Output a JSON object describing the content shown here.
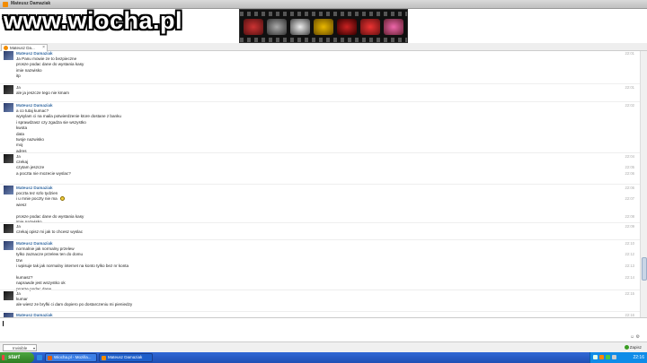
{
  "window": {
    "title": "Mateusz Damaziak"
  },
  "watermark": "www.wiocha.pl",
  "tab": {
    "label": "Mateusz Da..."
  },
  "messages": [
    {
      "sender": "Mateusz Damaziak",
      "kind": "mateusz",
      "time": "22:01",
      "lines": [
        "Ja Panu mowie ze to bezpieczne",
        "prosze podac dane do wystania kasy",
        "imie nazwisko",
        "itp"
      ]
    },
    {
      "sender": "Ja",
      "kind": "ja",
      "time": "22:01",
      "lines": [
        "ale ja jeszcze tego nie kmam"
      ]
    },
    {
      "sender": "Mateusz Damaziak",
      "kind": "mateusz",
      "time": "22:02",
      "lines": [
        "a co tutaj kumac?",
        "wysylam ci na maila potwierdzenie ktore dostane z banku",
        "i sprawdzasz czy zgadza sie wszystko",
        "kwota",
        "data",
        "twoje nazwisko",
        "moj",
        "adres"
      ]
    },
    {
      "sender": "Ja",
      "kind": "ja",
      "time": "22:04",
      "lines": [
        "czekaj",
        "czytam jeszcze",
        "a poczta nie mozecie wyslac?"
      ],
      "line_times": [
        "",
        "22:05",
        "22:06"
      ]
    },
    {
      "sender": "Mateusz Damaziak",
      "kind": "mateusz",
      "time": "22:06",
      "lines": [
        "poczta tez szlo tydzien",
        "i u mnie poczty nie ma",
        "wiesz",
        "",
        "prosze podac dane do wystania kasy",
        "imie nazwisko"
      ],
      "line_times": [
        "",
        "22:07",
        "",
        "",
        "22:08",
        ""
      ]
    },
    {
      "sender": "Ja",
      "kind": "ja",
      "time": "22:09",
      "lines": [
        "czekaj opisz mi jak to chcesz wyslac"
      ]
    },
    {
      "sender": "Mateusz Damaziak",
      "kind": "mateusz",
      "time": "22:10",
      "lines": [
        "normalnie jak normalny przelew",
        "tylko zaznacze przelew ten do domu",
        "tzw",
        "i wpisuje tak jak normalny internet na konto tylko bez nr konta",
        "",
        "kumasz?",
        "naprawde jest wszystko ok",
        "prosze podac dane"
      ],
      "line_times": [
        "",
        "22:12",
        "",
        "22:13",
        "",
        "22:14",
        "",
        ""
      ]
    },
    {
      "sender": "Ja",
      "kind": "ja",
      "time": "22:15",
      "lines": [
        "kumar",
        "ale wiesz ze bryfki ci dam dopiero po dostarczeniu mi pieniedzy"
      ]
    },
    {
      "sender": "Mateusz Damaziak",
      "kind": "mateusz",
      "time": "22:16",
      "lines": []
    }
  ],
  "bottombar": {
    "status": "Invisible",
    "send": "Zapisz"
  },
  "taskbar": {
    "start": "start",
    "tasks": [
      "Wiocha.pl - Mozilla...",
      "Mateusz Damaziak"
    ],
    "clock": "22:16"
  },
  "colors": {
    "accent": "#3a6ea5",
    "taskbar": "#1f4fb4",
    "start": "#3c8f2d"
  }
}
